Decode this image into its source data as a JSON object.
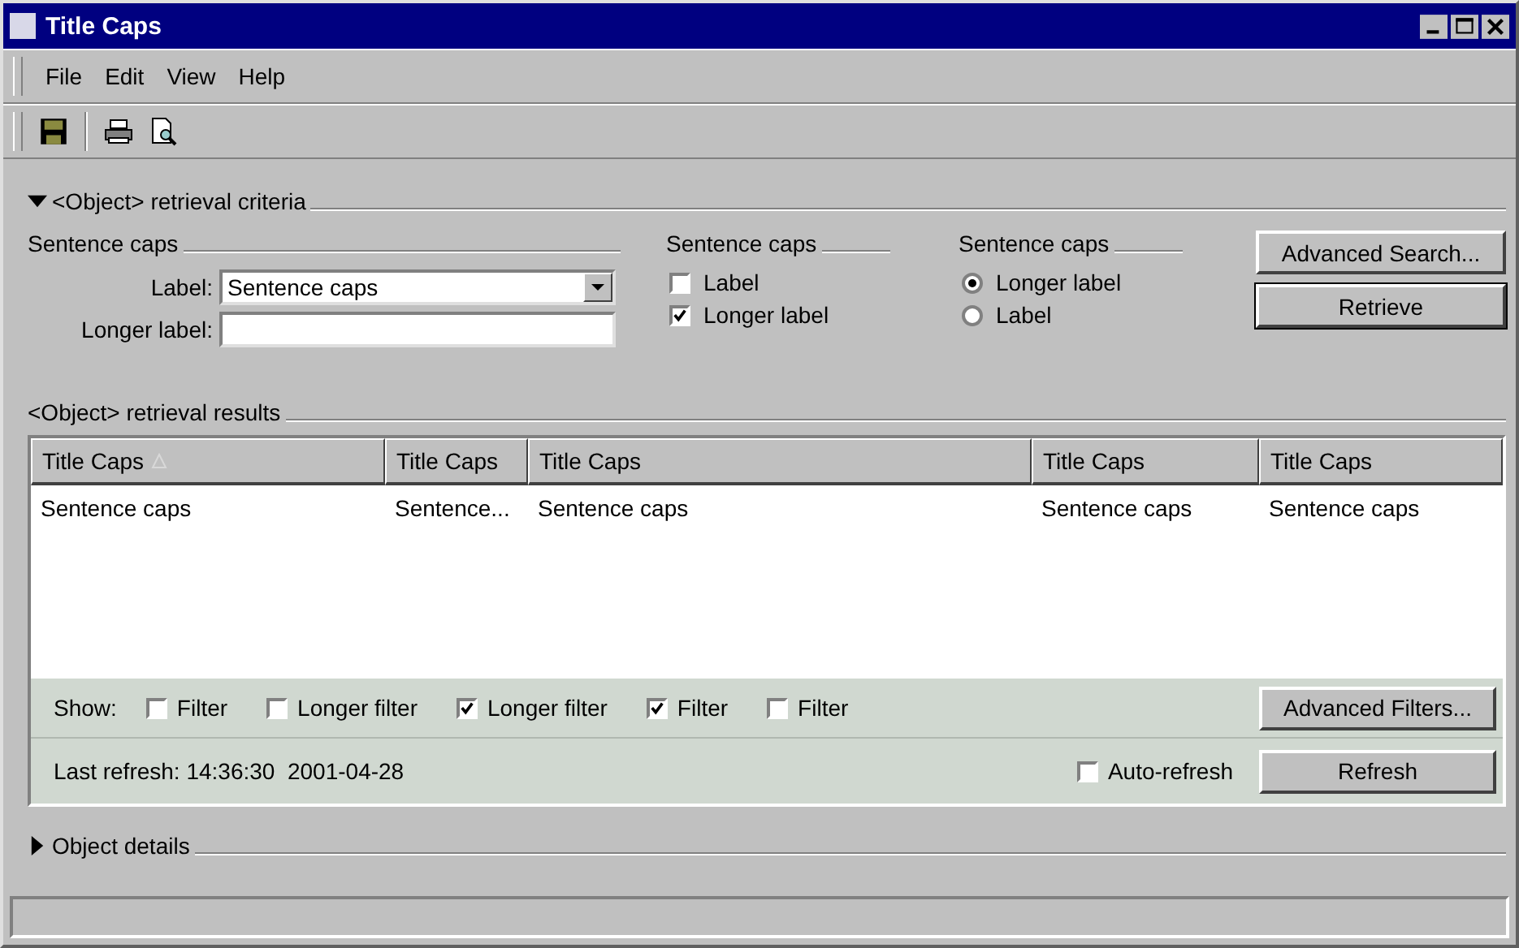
{
  "window": {
    "title": "Title Caps"
  },
  "menu": [
    "File",
    "Edit",
    "View",
    "Help"
  ],
  "criteria": {
    "title": "<Object> retrieval criteria",
    "expanded": true,
    "fields_group": {
      "title": "Sentence caps",
      "fields": [
        {
          "label": "Label:",
          "kind": "dropdown",
          "value": "Sentence caps"
        },
        {
          "label": "Longer label:",
          "kind": "text"
        }
      ]
    },
    "checkbox_group": {
      "title": "Sentence caps",
      "items": [
        {
          "label": "Label",
          "checked": false
        },
        {
          "label": "Longer label",
          "checked": true
        }
      ]
    },
    "radio_group": {
      "title": "Sentence caps",
      "items": [
        {
          "label": "Longer label",
          "selected": true
        },
        {
          "label": "Label",
          "selected": false
        }
      ]
    },
    "buttons": [
      {
        "label": "Advanced Search...",
        "default": false
      },
      {
        "label": "Retrieve",
        "default": true
      }
    ]
  },
  "results": {
    "title": "<Object> retrieval results",
    "columns": [
      {
        "label": "Title Caps",
        "sorted": true
      },
      {
        "label": "Title Caps",
        "sorted": false
      },
      {
        "label": "Title Caps",
        "sorted": false
      },
      {
        "label": "Title Caps",
        "sorted": false
      },
      {
        "label": "Title Caps",
        "sorted": false
      }
    ],
    "rows": [
      [
        "Sentence caps",
        "Sentence...",
        "Sentence caps",
        "Sentence caps",
        "Sentence caps"
      ]
    ],
    "filters": {
      "label": "Show:",
      "items": [
        {
          "label": "Filter",
          "checked": false
        },
        {
          "label": "Longer filter",
          "checked": false
        },
        {
          "label": "Longer filter",
          "checked": true
        },
        {
          "label": "Filter",
          "checked": true
        },
        {
          "label": "Filter",
          "checked": false
        }
      ],
      "button": "Advanced Filters..."
    },
    "refresh": {
      "text": "Last refresh: 14:36:30  2001-04-28",
      "auto_refresh": {
        "label": "Auto-refresh",
        "checked": false
      },
      "button": "Refresh"
    }
  },
  "details": {
    "title": "Object details",
    "expanded": false
  }
}
